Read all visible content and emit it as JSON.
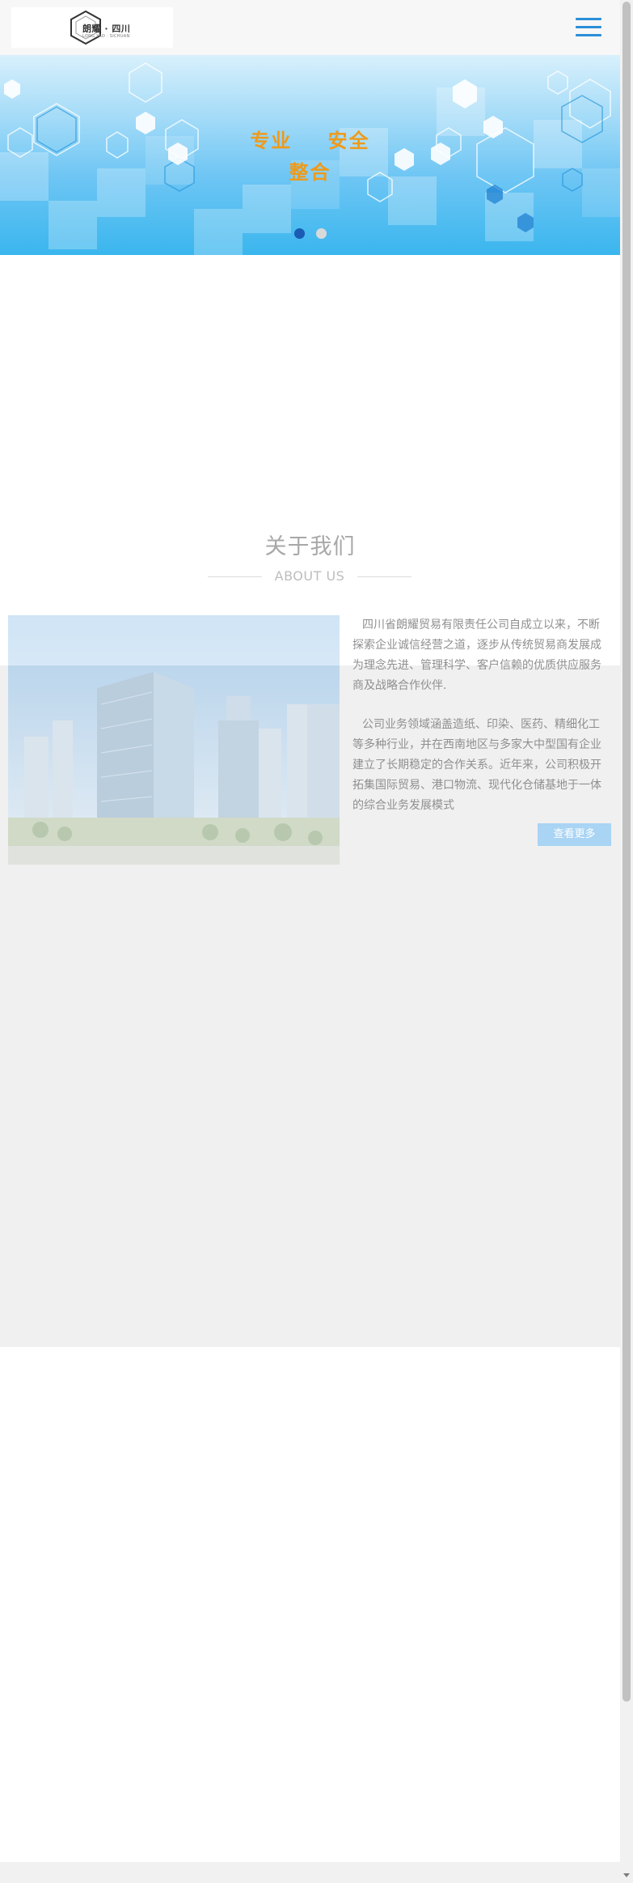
{
  "header": {
    "logo_text": "朗耀 · 四川",
    "logo_subtext": "LONG YAO · SICHUAN",
    "menu_icon": "hamburger-menu-icon"
  },
  "banner": {
    "words_line1": "专业 安全",
    "words_line2": "整合",
    "slide_count": 2,
    "active_slide": 1,
    "text_color": "#ef9a1a"
  },
  "about": {
    "title": "关于我们",
    "subtitle": "ABOUT US",
    "paragraph1": "四川省朗耀贸易有限责任公司自成立以来，不断探索企业诚信经营之道，逐步从传统贸易商发展成为理念先进、管理科学、客户信赖的优质供应服务商及战略合作伙伴.",
    "paragraph2": "公司业务领域涵盖造纸、印染、医药、精细化工等多种行业，并在西南地区与多家大中型国有企业建立了长期稳定的合作关系。近年来，公司积极开拓集国际贸易、港口物流、现代化仓储基地于一体的综合业务发展模式",
    "more_button": "查看更多"
  },
  "colors": {
    "accent": "#2b8fd8",
    "button": "#a9d4f4"
  }
}
